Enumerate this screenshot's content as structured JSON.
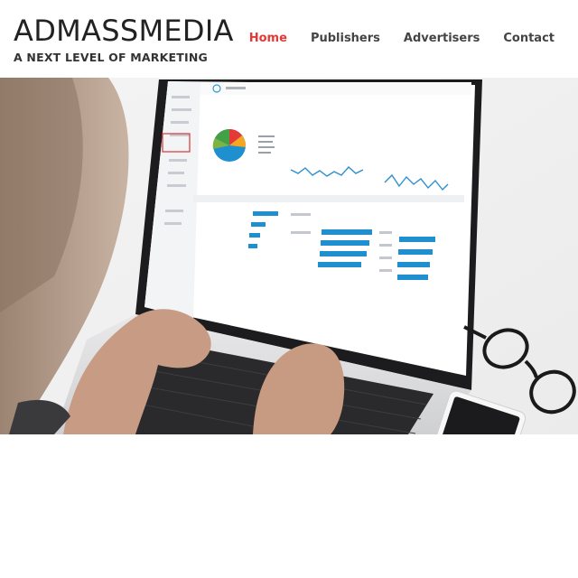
{
  "header": {
    "brand_title": "ADMASSMEDIA",
    "tagline": "A NEXT LEVEL OF MARKETING"
  },
  "nav": {
    "items": [
      {
        "label": "Home",
        "active": true
      },
      {
        "label": "Publishers",
        "active": false
      },
      {
        "label": "Advertisers",
        "active": false
      },
      {
        "label": "Contact",
        "active": false
      }
    ]
  },
  "colors": {
    "nav_active": "#e53935",
    "nav_default": "#444444",
    "brand_text": "#222222",
    "dashboard_accent": "#1e90d0"
  },
  "hero": {
    "image_description": "person typing on laptop showing analytics dashboard, glasses and phone on desk"
  }
}
